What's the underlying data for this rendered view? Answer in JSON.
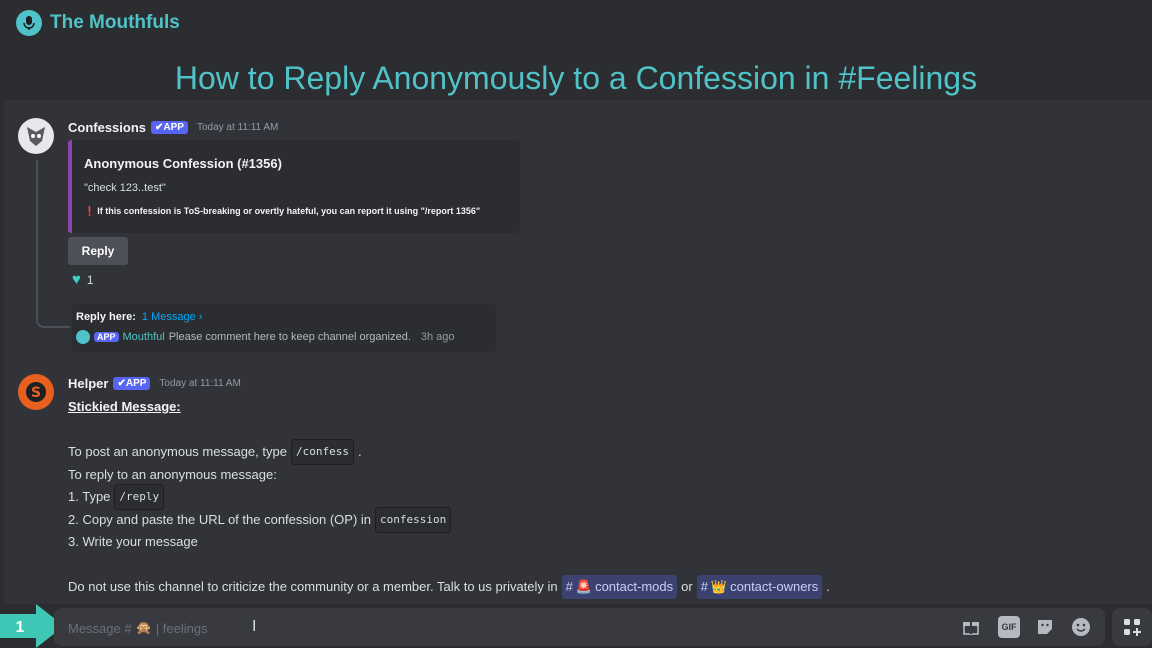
{
  "brand": {
    "name": "The Mouthfuls"
  },
  "headline": "How to Reply Anonymously to a Confession in #Feelings",
  "confession_message": {
    "author": "Confessions",
    "badge": "✔APP",
    "timestamp": "Today at 11:11 AM",
    "embed": {
      "title": "Anonymous Confession (#1356)",
      "text": "\"check 123..test\"",
      "warning": "If this confession is ToS-breaking or overtly hateful, you can report it using \"/report 1356\""
    },
    "reply_label": "Reply",
    "reaction_count": "1",
    "thread": {
      "label": "Reply here:",
      "link": "1 Message ›",
      "app_badge": "APP",
      "author": "Mouthful",
      "text": "Please comment here to keep channel organized.",
      "ago": "3h ago"
    }
  },
  "helper_message": {
    "author": "Helper",
    "badge": "✔APP",
    "timestamp": "Today at 11:11 AM",
    "heading": "Stickied Message:",
    "line1_pre": "To post an anonymous message, type",
    "line1_code": "/confess",
    "line1_post": ".",
    "line2": "To reply to an anonymous message:",
    "line3_pre": "1. Type",
    "line3_code": "/reply",
    "line4_pre": "2. Copy and paste the URL of the confession (OP) in",
    "line4_code": "confession",
    "line5": "3. Write your message",
    "line6_pre": "Do not use this channel to criticize the community or a member. Talk to us privately in",
    "chan1": "contact-mods",
    "line6_mid": "or",
    "chan2": "contact-owners",
    "line6_post": "."
  },
  "input": {
    "placeholder_pre": "Message #",
    "placeholder_channel": "| feelings"
  },
  "step": {
    "number": "1"
  },
  "colors": {
    "accent": "#4fc3c7",
    "blurple": "#5865f2",
    "embed_bar": "#8e44ad"
  }
}
